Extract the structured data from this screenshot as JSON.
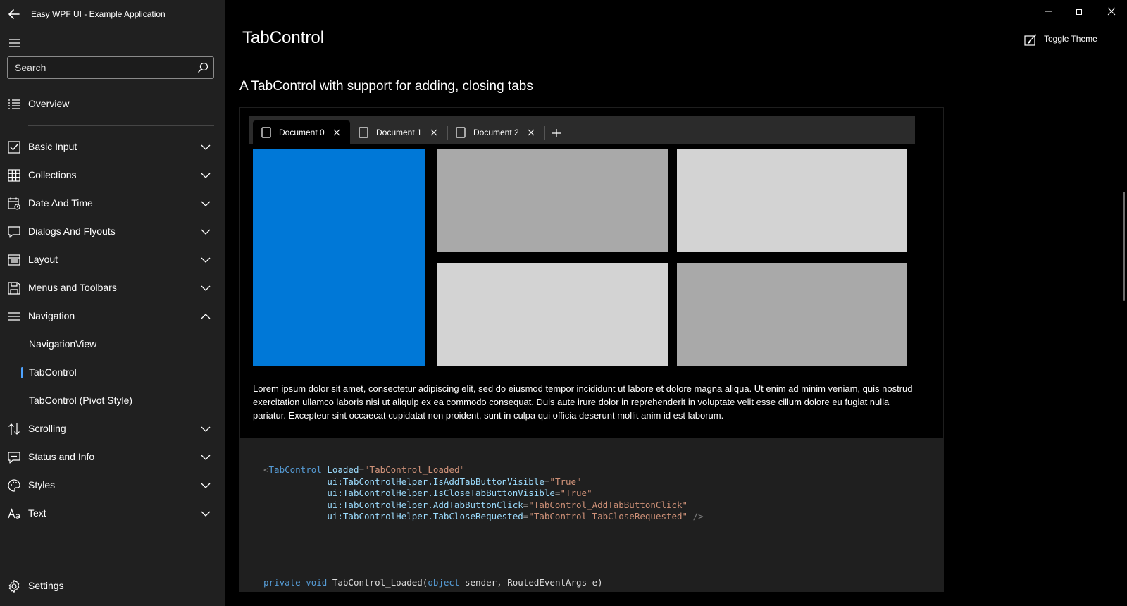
{
  "app": {
    "title": "Easy WPF UI - Example Application"
  },
  "search": {
    "placeholder": "Search",
    "value": ""
  },
  "sidebar": {
    "top_item": {
      "label": "Overview",
      "icon": "list-icon"
    },
    "groups": [
      {
        "label": "Basic Input",
        "icon": "checkbox-icon",
        "expanded": false
      },
      {
        "label": "Collections",
        "icon": "grid-icon",
        "expanded": false
      },
      {
        "label": "Date And Time",
        "icon": "calendar-icon",
        "expanded": false
      },
      {
        "label": "Dialogs And Flyouts",
        "icon": "chat-icon",
        "expanded": false
      },
      {
        "label": "Layout",
        "icon": "layout-icon",
        "expanded": false
      },
      {
        "label": "Menus and Toolbars",
        "icon": "save-icon",
        "expanded": false
      },
      {
        "label": "Navigation",
        "icon": "navigation-icon",
        "expanded": true
      },
      {
        "label": "Scrolling",
        "icon": "sort-arrows-icon",
        "expanded": false
      },
      {
        "label": "Status and Info",
        "icon": "status-icon",
        "expanded": false
      },
      {
        "label": "Styles",
        "icon": "palette-icon",
        "expanded": false
      },
      {
        "label": "Text",
        "icon": "text-icon",
        "expanded": false
      }
    ],
    "navigation_children": [
      {
        "label": "NavigationView",
        "selected": false
      },
      {
        "label": "TabControl",
        "selected": true
      },
      {
        "label": "TabControl (Pivot Style)",
        "selected": false
      }
    ],
    "settings": {
      "label": "Settings",
      "icon": "gear-icon"
    },
    "accent_color": "#4ea3ff"
  },
  "header": {
    "page_title": "TabControl",
    "toggle_theme_label": "Toggle Theme"
  },
  "example": {
    "title": "A TabControl with support for adding, closing tabs",
    "tabs": [
      {
        "label": "Document 0",
        "selected": true
      },
      {
        "label": "Document 1",
        "selected": false
      },
      {
        "label": "Document 2",
        "selected": false
      }
    ],
    "tile_colors": [
      "#0078d7",
      "#a9a9a9",
      "#d3d3d3",
      "#d3d3d3",
      "#a9a9a9"
    ],
    "body_text": "Lorem ipsum dolor sit amet, consectetur adipiscing elit, sed do eiusmod tempor incididunt ut labore et dolore magna aliqua. Ut enim ad minim veniam, quis nostrud exercitation ullamco laboris nisi ut aliquip ex ea commodo consequat. Duis aute irure dolor in reprehenderit in voluptate velit esse cillum dolore eu fugiat nulla pariatur. Excepteur sint occaecat cupidatat non proident, sunt in culpa qui officia deserunt mollit anim id est laborum."
  },
  "code": {
    "xaml_tag": "TabControl",
    "xaml_attrs": [
      {
        "name": "Loaded",
        "value": "TabControl_Loaded"
      },
      {
        "name": "ui:TabControlHelper.IsAddTabButtonVisible",
        "value": "True"
      },
      {
        "name": "ui:TabControlHelper.IsCloseTabButtonVisible",
        "value": "True"
      },
      {
        "name": "ui:TabControlHelper.AddTabButtonClick",
        "value": "TabControl_AddTabButtonClick"
      },
      {
        "name": "ui:TabControlHelper.TabCloseRequested",
        "value": "TabControl_TabCloseRequested"
      }
    ],
    "csharp_kw1": "private",
    "csharp_kw2": "void",
    "csharp_method": "TabControl_Loaded(",
    "csharp_kw3": "object",
    "csharp_rest": " sender, RoutedEventArgs e)"
  }
}
